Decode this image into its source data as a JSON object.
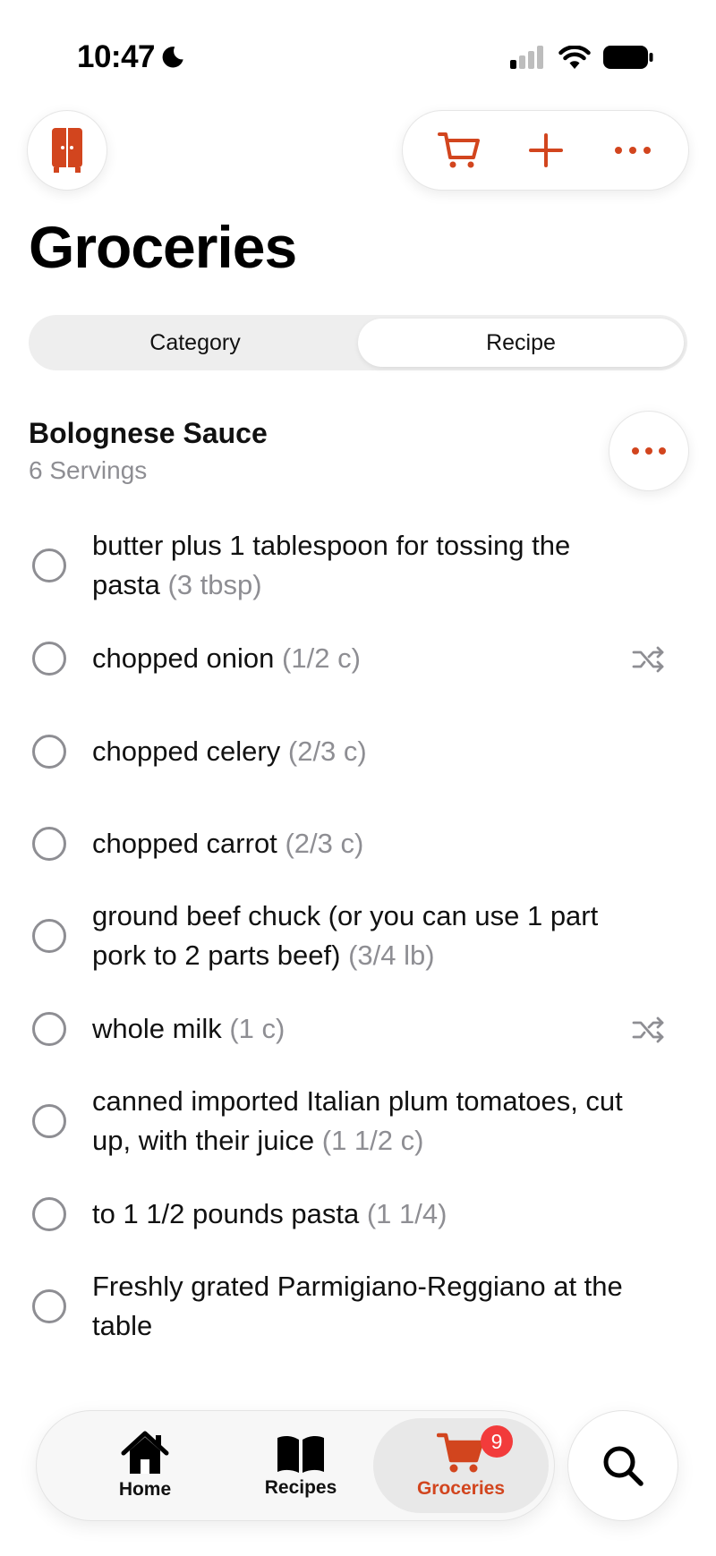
{
  "status_bar": {
    "time": "10:47"
  },
  "title": "Groceries",
  "segments": [
    {
      "label": "Category",
      "active": false
    },
    {
      "label": "Recipe",
      "active": true
    }
  ],
  "recipe": {
    "name": "Bolognese Sauce",
    "servings": "6 Servings"
  },
  "items": [
    {
      "name": "butter plus 1 tablespoon for tossing the pasta",
      "qty": "(3 tbsp)",
      "substitute": false
    },
    {
      "name": "chopped onion",
      "qty": "(1/2 c)",
      "substitute": true
    },
    {
      "name": "chopped celery",
      "qty": "(2/3 c)",
      "substitute": false
    },
    {
      "name": "chopped carrot",
      "qty": "(2/3 c)",
      "substitute": false
    },
    {
      "name": "ground beef chuck (or you can use 1 part pork to 2 parts beef)",
      "qty": "(3/4 lb)",
      "substitute": false
    },
    {
      "name": "whole milk",
      "qty": "(1 c)",
      "substitute": true
    },
    {
      "name": "canned imported Italian plum tomatoes, cut up, with their juice",
      "qty": "(1 1/2 c)",
      "substitute": false
    },
    {
      "name": "to 1 1/2 pounds pasta",
      "qty": "(1 1/4)",
      "substitute": false
    },
    {
      "name": "Freshly grated Parmigiano-Reggiano at the table",
      "qty": "",
      "substitute": false
    }
  ],
  "tabs": [
    {
      "label": "Home",
      "icon": "house-icon",
      "active": false
    },
    {
      "label": "Recipes",
      "icon": "book-icon",
      "active": false
    },
    {
      "label": "Groceries",
      "icon": "cart-icon",
      "active": true,
      "badge": "9"
    }
  ],
  "colors": {
    "accent": "#d2451e",
    "badge": "#f23b3b",
    "muted": "#8e8e93"
  },
  "icons": {
    "top_left": "pantry-icon",
    "toolbar": [
      "cart-icon",
      "plus-icon",
      "more-icon"
    ],
    "search": "search-icon"
  }
}
